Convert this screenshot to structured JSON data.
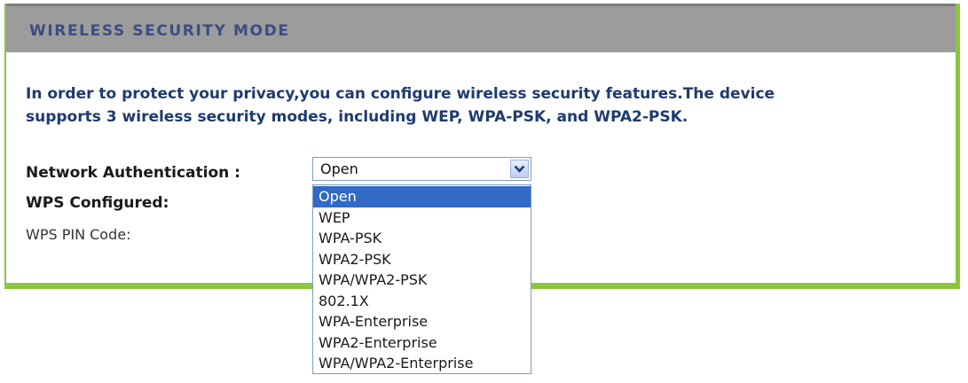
{
  "header": {
    "title": "WIRELESS SECURITY MODE"
  },
  "intro": {
    "line1": "In order to protect your privacy,you can configure wireless security features.The device",
    "line2": "supports 3 wireless security modes, including WEP, WPA-PSK, and WPA2-PSK."
  },
  "form": {
    "network_auth_label": "Network Authentication :",
    "wps_configured_label": "WPS Configured:",
    "wps_pin_label": "WPS PIN Code:",
    "network_auth_value": "Open"
  },
  "dropdown": {
    "options": [
      "Open",
      "WEP",
      "WPA-PSK",
      "WPA2-PSK",
      "WPA/WPA2-PSK",
      "802.1X",
      "WPA-Enterprise",
      "WPA2-Enterprise",
      "WPA/WPA2-Enterprise"
    ],
    "highlighted": "Open"
  },
  "colors": {
    "accent_green": "#8cc63f",
    "header_gray": "#9c9c9c",
    "header_text": "#3b4d84",
    "selection_blue": "#3169c6"
  },
  "icons": {
    "select_arrow": "chevron-down-icon"
  }
}
